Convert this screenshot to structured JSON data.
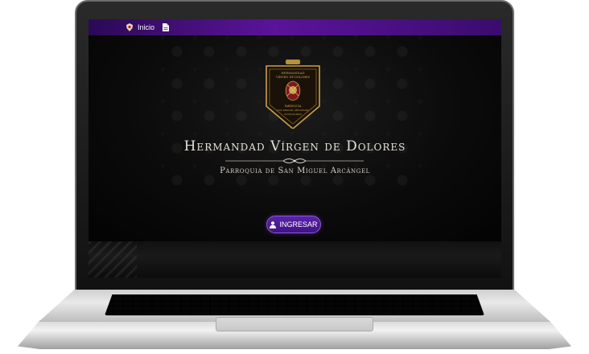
{
  "nav": {
    "home_label": "Inicio",
    "home_icon": "shield-icon",
    "doc_icon": "document-icon"
  },
  "hero": {
    "title": "Hermandad Vírgen de Dolores",
    "subtitle": "Parroquia de San Miguel Arcángel",
    "crest_lines": [
      "Hermandad",
      "Vírgen de Dolores",
      "Parroquia",
      "San Miguel Arcángel",
      "Totonicapán"
    ]
  },
  "button": {
    "label": "INGRESAR",
    "icon": "user-icon"
  },
  "colors": {
    "accent": "#5b1399",
    "button": "#4a1a95",
    "gold": "#c9a04a"
  }
}
